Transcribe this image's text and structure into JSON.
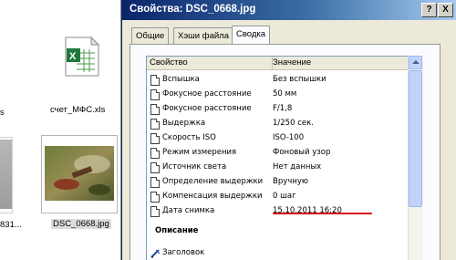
{
  "explorer": {
    "left_fragment_top": "s",
    "left_fragment_bottom": "831...",
    "file1_name": "счет_МФС.xls",
    "file2_name": "DSC_0668.jpg"
  },
  "dialog": {
    "title": "Свойства: DSC_0668.jpg",
    "help_label": "?",
    "close_label": "X",
    "tabs": [
      "Общие",
      "Хэши файла",
      "Сводка"
    ],
    "active_tab": "Сводка",
    "columns": {
      "property": "Свойство",
      "value": "Значение"
    },
    "rows": [
      {
        "property": "Вспышка",
        "value": "Без вспышки"
      },
      {
        "property": "Фокусное расстояние",
        "value": "50 мм"
      },
      {
        "property": "Фокусное расстояние",
        "value": "F/1,8"
      },
      {
        "property": "Выдержка",
        "value": "1/250 сек."
      },
      {
        "property": "Скорость ISO",
        "value": "ISO-100"
      },
      {
        "property": "Режим измерения",
        "value": "Фоновый узор"
      },
      {
        "property": "Источник света",
        "value": "Нет данных"
      },
      {
        "property": "Определение выдержки",
        "value": "Вручную"
      },
      {
        "property": "Компенсация выдержки",
        "value": "0 шаг"
      },
      {
        "property": "Дата снимка",
        "value": "15.10.2011 16:20"
      }
    ],
    "section_title": "Описание",
    "heading_label": "Заголовок",
    "highlight_color": "#d21010"
  }
}
